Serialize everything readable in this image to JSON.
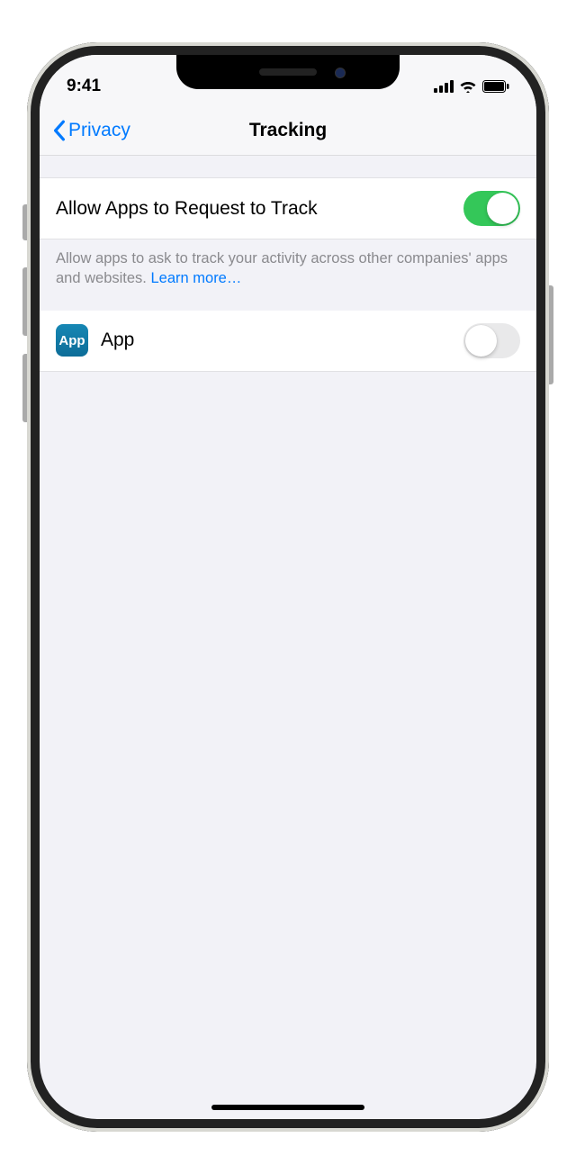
{
  "status": {
    "time": "9:41"
  },
  "nav": {
    "back": "Privacy",
    "title": "Tracking"
  },
  "allow_section": {
    "label": "Allow Apps to Request to Track",
    "switch_on": true,
    "footer_prefix": "Allow apps to ask to track your activity across other companies' apps and websites. ",
    "footer_link": "Learn more…"
  },
  "apps": [
    {
      "name": "App",
      "icon_text": "App",
      "switch_on": false
    }
  ],
  "colors": {
    "tint": "#007aff",
    "switch_on": "#34c759",
    "group_bg": "#f2f2f7"
  }
}
